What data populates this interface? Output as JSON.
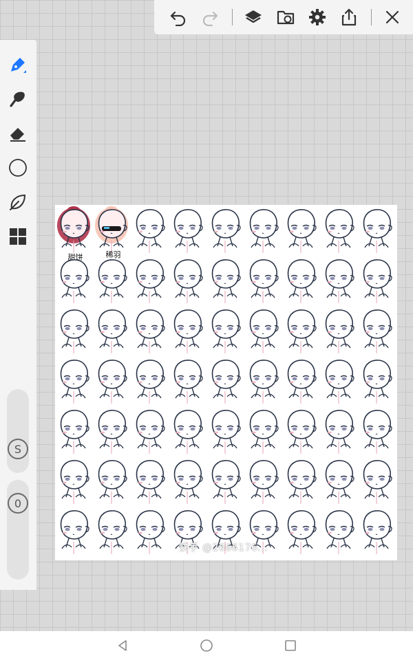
{
  "toolbar": {
    "icons": [
      "undo-icon",
      "redo-icon",
      "layers-icon",
      "file-sync-icon",
      "gear-icon",
      "share-icon",
      "close-icon"
    ]
  },
  "tools": {
    "icons": [
      "pen-icon",
      "brush-icon",
      "eraser-icon",
      "shape-circle-icon",
      "leaf-icon",
      "grid-icon"
    ],
    "size_label": "S",
    "opacity_label": "0"
  },
  "canvas": {
    "characters": [
      {
        "label": "甜饼",
        "hair_color": "#b1344a"
      },
      {
        "label": "稀羽",
        "hair_color": "#f6c3b4"
      }
    ],
    "template_rows": 7,
    "template_cols": 9,
    "watermark": "快手 @2666176..."
  },
  "nav": {
    "icons": [
      "back-icon",
      "home-icon",
      "recents-icon"
    ]
  },
  "colors": {
    "accent": "#1e78ff",
    "toolbar_bg": "#f4f4f4",
    "icon": "#333333"
  }
}
